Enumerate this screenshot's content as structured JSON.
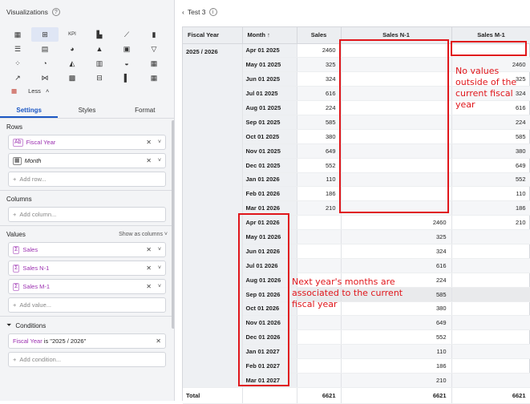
{
  "visualizations": {
    "title": "Visualizations",
    "icons": [
      "table-icon",
      "pivot-table-icon",
      "kpi-icon",
      "bar-chart-icon",
      "line-chart-icon",
      "column-chart-icon",
      "horizontal-bar-icon",
      "stacked-bar-icon",
      "donut-chart-icon",
      "pyramid-chart-icon",
      "map-icon",
      "funnel-icon",
      "scatter-icon",
      "pie-chart-icon",
      "area-chart-icon",
      "combo-chart-icon",
      "gauge-icon",
      "waterfall-icon",
      "trend-icon",
      "sankey-icon",
      "treemap-icon",
      "boxplot-icon",
      "histogram-icon",
      "heatmap-icon",
      "calendar-icon"
    ],
    "icon_glyphs": [
      "▦",
      "⊞",
      "KPI",
      "▙",
      "⟋",
      "▮",
      "☰",
      "▤",
      "◕",
      "▲",
      "▣",
      "▽",
      "⁘",
      "◔",
      "◭",
      "▥",
      "◒",
      "▦",
      "↗",
      "⋈",
      "▩",
      "⊟",
      "▌",
      "▦",
      "▦"
    ],
    "less_label": "Less"
  },
  "tabs": [
    "Settings",
    "Styles",
    "Format"
  ],
  "rows": {
    "title": "Rows",
    "items": [
      {
        "label": "Fiscal Year",
        "type": "attr"
      },
      {
        "label": "Month",
        "type": "date"
      }
    ],
    "add": "Add row..."
  },
  "columns": {
    "title": "Columns",
    "add": "Add column..."
  },
  "values": {
    "title": "Values",
    "show_as": "Show as columns",
    "items": [
      "Sales",
      "Sales N-1",
      "Sales M-1"
    ],
    "add": "Add value..."
  },
  "conditions": {
    "title": "Conditions",
    "field": "Fiscal Year",
    "op": "is",
    "value": "\"2025 / 2026\"",
    "add": "Add condition..."
  },
  "report": {
    "title": "Test 3",
    "headers": [
      "Fiscal Year",
      "Month",
      "Sales",
      "Sales N-1",
      "Sales M-1"
    ],
    "fiscal_year": "2025 / 2026",
    "rows": [
      {
        "month": "Apr 01 2025",
        "sales": "2460",
        "n1": "",
        "m1": ""
      },
      {
        "month": "May 01 2025",
        "sales": "325",
        "n1": "",
        "m1": "2460"
      },
      {
        "month": "Jun 01 2025",
        "sales": "324",
        "n1": "",
        "m1": "325"
      },
      {
        "month": "Jul 01 2025",
        "sales": "616",
        "n1": "",
        "m1": "324"
      },
      {
        "month": "Aug 01 2025",
        "sales": "224",
        "n1": "",
        "m1": "616"
      },
      {
        "month": "Sep 01 2025",
        "sales": "585",
        "n1": "",
        "m1": "224"
      },
      {
        "month": "Oct 01 2025",
        "sales": "380",
        "n1": "",
        "m1": "585"
      },
      {
        "month": "Nov 01 2025",
        "sales": "649",
        "n1": "",
        "m1": "380"
      },
      {
        "month": "Dec 01 2025",
        "sales": "552",
        "n1": "",
        "m1": "649"
      },
      {
        "month": "Jan 01 2026",
        "sales": "110",
        "n1": "",
        "m1": "552"
      },
      {
        "month": "Feb 01 2026",
        "sales": "186",
        "n1": "",
        "m1": "110"
      },
      {
        "month": "Mar 01 2026",
        "sales": "210",
        "n1": "",
        "m1": "186"
      },
      {
        "month": "Apr 01 2026",
        "sales": "",
        "n1": "2460",
        "m1": "210"
      },
      {
        "month": "May 01 2026",
        "sales": "",
        "n1": "325",
        "m1": ""
      },
      {
        "month": "Jun 01 2026",
        "sales": "",
        "n1": "324",
        "m1": ""
      },
      {
        "month": "Jul 01 2026",
        "sales": "",
        "n1": "616",
        "m1": ""
      },
      {
        "month": "Aug 01 2026",
        "sales": "",
        "n1": "224",
        "m1": ""
      },
      {
        "month": "Sep 01 2026",
        "sales": "",
        "n1": "585",
        "m1": ""
      },
      {
        "month": "Oct 01 2026",
        "sales": "",
        "n1": "380",
        "m1": ""
      },
      {
        "month": "Nov 01 2026",
        "sales": "",
        "n1": "649",
        "m1": ""
      },
      {
        "month": "Dec 01 2026",
        "sales": "",
        "n1": "552",
        "m1": ""
      },
      {
        "month": "Jan 01 2027",
        "sales": "",
        "n1": "110",
        "m1": ""
      },
      {
        "month": "Feb 01 2027",
        "sales": "",
        "n1": "186",
        "m1": ""
      },
      {
        "month": "Mar 01 2027",
        "sales": "",
        "n1": "210",
        "m1": ""
      }
    ],
    "total": {
      "label": "Total",
      "sales": "6621",
      "n1": "6621",
      "m1": "6621"
    }
  },
  "annotations": {
    "no_values": "No values outside of the current fiscal year",
    "next_year": "Next year's months are associated to the current fiscal year",
    "color": "#e0161b"
  }
}
